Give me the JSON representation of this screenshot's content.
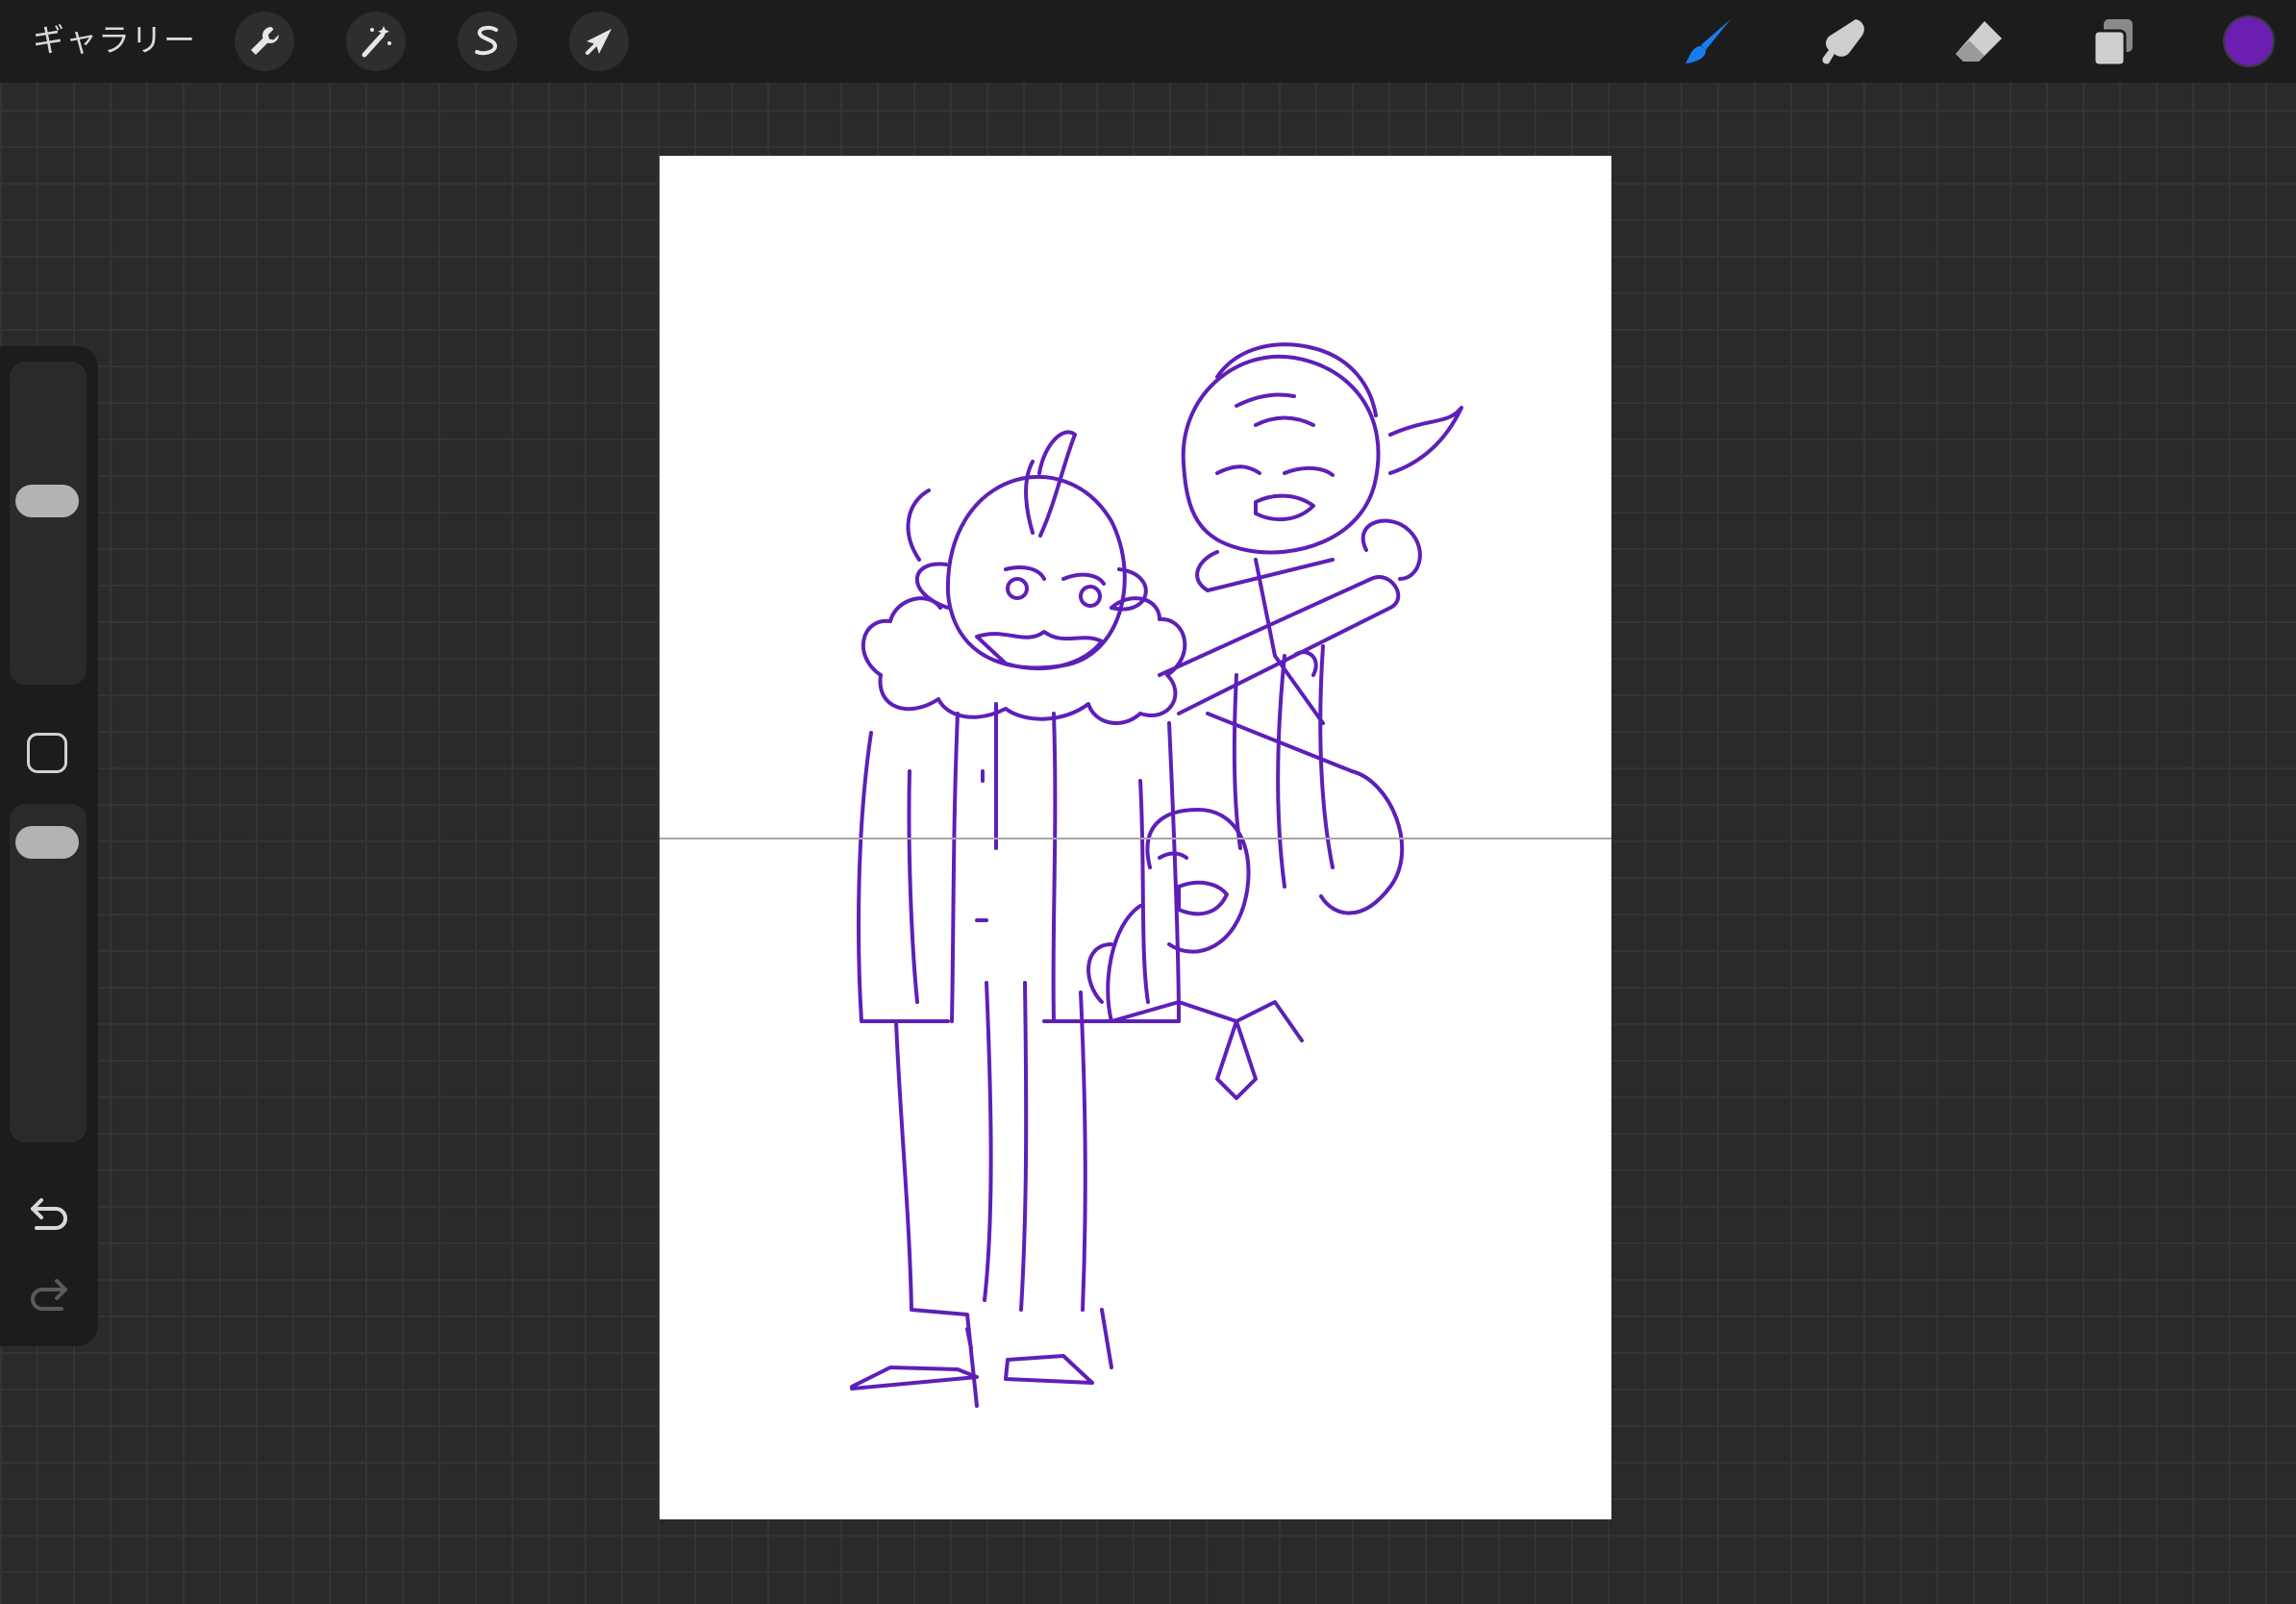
{
  "topbar": {
    "gallery_label": "ギャラリー",
    "left_tools": [
      {
        "name": "actions",
        "icon": "wrench-icon"
      },
      {
        "name": "adjustments",
        "icon": "magic-wand-icon"
      },
      {
        "name": "selection",
        "icon": "selection-s-icon"
      },
      {
        "name": "transform",
        "icon": "arrow-cursor-icon"
      }
    ],
    "right_tools": [
      {
        "name": "brush",
        "icon": "brush-icon",
        "active": true
      },
      {
        "name": "smudge",
        "icon": "smudge-finger-icon",
        "active": false
      },
      {
        "name": "eraser",
        "icon": "eraser-icon",
        "active": false
      },
      {
        "name": "layers",
        "icon": "layers-icon",
        "active": false
      }
    ],
    "current_color": "#6a1fb0"
  },
  "sidebar": {
    "brush_size_level": 0.58,
    "opacity_level": 0.95
  },
  "colors": {
    "accent": "#1a7cf0",
    "stroke": "#5e1fb8",
    "canvas": "#ffffff"
  }
}
